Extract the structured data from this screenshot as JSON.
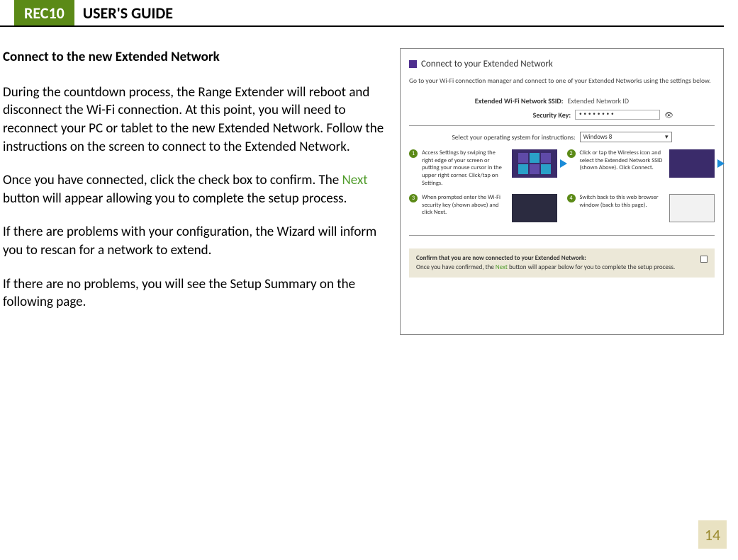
{
  "header": {
    "tab": "REC10",
    "title": "USER'S GUIDE"
  },
  "left": {
    "section_title": "Connect to the new Extended Network",
    "p1": "During the countdown process, the Range Extender will reboot and disconnect the Wi-Fi connection. At this point, you will need to reconnect your PC or tablet to the new Extended Network. Follow the instructions on the screen to connect to the Extended Network.",
    "p2a": "Once you have connected, click the check box to confirm. The ",
    "p2_next": "Next",
    "p2b": " button will appear allowing you to complete the setup process.",
    "p3": "If there are problems with your configuration, the Wizard will inform you to rescan for a network to extend.",
    "p4": "If there are no problems, you will see the Setup Summary on the following page."
  },
  "panel": {
    "title": "Connect to your Extended Network",
    "sub": "Go to your Wi-Fi connection manager and connect to one of your Extended Networks using the settings below.",
    "ssid_label": "Extended Wi-Fi Network SSID:",
    "ssid_value": "Extended Network ID",
    "key_label": "Security Key:",
    "key_value": "••••••••",
    "os_label": "Select your operating system for instructions:",
    "os_value": "Windows 8",
    "steps": {
      "s1": "Access Settings by swiping the right edge of your screen or putting your mouse cursor in the upper right corner. Click/tap on Settings.",
      "s2": "Click or tap the Wireless icon and select the Extended Network SSID (shown Above). Click Connect.",
      "s3": "When prompted enter the Wi-Fi security key (shown above) and click Next.",
      "s4": "Switch back to this web browser window (back to this page)."
    },
    "confirm_title": "Confirm that you are now connected to your Extended Network:",
    "confirm_body_a": "Once you have confirmed, the ",
    "confirm_next": "Next",
    "confirm_body_b": " button will appear below for you to complete the setup process."
  },
  "page_number": "14"
}
